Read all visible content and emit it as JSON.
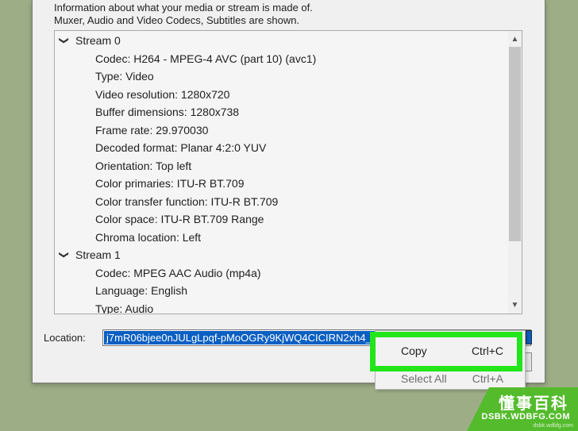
{
  "info": {
    "line1": "Information about what your media or stream is made of.",
    "line2": "Muxer, Audio and Video Codecs, Subtitles are shown."
  },
  "tree": {
    "streams": [
      {
        "label": "Stream 0",
        "props": [
          "Codec: H264 - MPEG-4 AVC (part 10) (avc1)",
          "Type: Video",
          "Video resolution: 1280x720",
          "Buffer dimensions: 1280x738",
          "Frame rate: 29.970030",
          "Decoded format: Planar 4:2:0 YUV",
          "Orientation: Top left",
          "Color primaries: ITU-R BT.709",
          "Color transfer function: ITU-R BT.709",
          "Color space: ITU-R BT.709 Range",
          "Chroma location: Left"
        ]
      },
      {
        "label": "Stream 1",
        "props": [
          "Codec: MPEG AAC Audio (mp4a)",
          "Language: English",
          "Type: Audio"
        ]
      }
    ]
  },
  "location": {
    "label": "Location:",
    "value": "j7mR06bjee0nJULgLpqf-pMoOGRy9KjWQ4CICIRN2xh4_rh"
  },
  "context_menu": {
    "copy_label": "Copy",
    "copy_shortcut": "Ctrl+C",
    "select_all_label": "Select All",
    "select_all_shortcut": "Ctrl+A"
  },
  "watermark": {
    "cn": "懂事百科",
    "en": "DSBK.WDBFG.COM",
    "sub": "dsbk.wdbfg.com"
  },
  "colors": {
    "highlight": "#22e51a",
    "selection": "#0a5fc2",
    "background": "#9dae86"
  }
}
